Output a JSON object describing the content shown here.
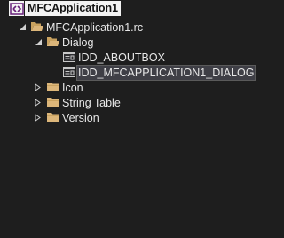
{
  "tree": {
    "root": {
      "label": "MFCApplication1",
      "icon": "project-icon"
    },
    "rc_file": {
      "label": "MFCApplication1.rc",
      "icon": "folder-open-icon",
      "expanded": true
    },
    "dialog_folder": {
      "label": "Dialog",
      "icon": "folder-open-icon",
      "expanded": true
    },
    "dialogs": [
      {
        "label": "IDD_ABOUTBOX",
        "icon": "dialog-resource-icon"
      },
      {
        "label": "IDD_MFCAPPLICATION1_DIALOG",
        "icon": "dialog-resource-icon",
        "selected": true
      }
    ],
    "collapsed_folders": [
      {
        "label": "Icon",
        "icon": "folder-icon",
        "expanded": false
      },
      {
        "label": "String Table",
        "icon": "folder-icon",
        "expanded": false
      },
      {
        "label": "Version",
        "icon": "folder-icon",
        "expanded": false
      }
    ]
  },
  "colors": {
    "background": "#1e1e1e",
    "text": "#e8e8e8",
    "folder": "#dcb67a",
    "selection": "#3f3f46"
  }
}
